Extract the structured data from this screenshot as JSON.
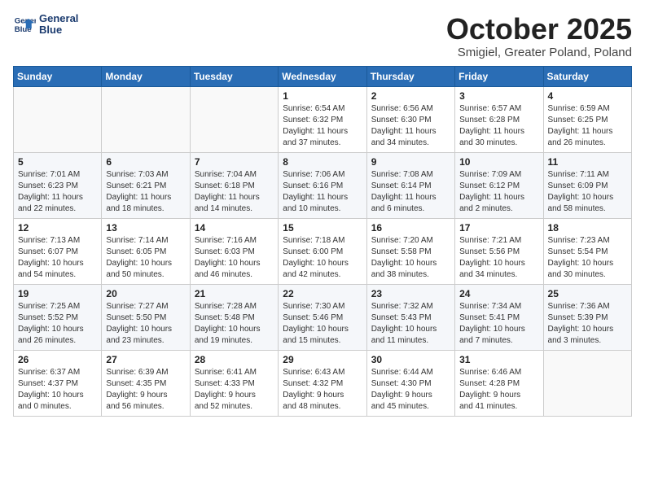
{
  "header": {
    "logo_line1": "General",
    "logo_line2": "Blue",
    "month_title": "October 2025",
    "subtitle": "Smigiel, Greater Poland, Poland"
  },
  "days_of_week": [
    "Sunday",
    "Monday",
    "Tuesday",
    "Wednesday",
    "Thursday",
    "Friday",
    "Saturday"
  ],
  "weeks": [
    [
      {
        "day": "",
        "info": ""
      },
      {
        "day": "",
        "info": ""
      },
      {
        "day": "",
        "info": ""
      },
      {
        "day": "1",
        "info": "Sunrise: 6:54 AM\nSunset: 6:32 PM\nDaylight: 11 hours\nand 37 minutes."
      },
      {
        "day": "2",
        "info": "Sunrise: 6:56 AM\nSunset: 6:30 PM\nDaylight: 11 hours\nand 34 minutes."
      },
      {
        "day": "3",
        "info": "Sunrise: 6:57 AM\nSunset: 6:28 PM\nDaylight: 11 hours\nand 30 minutes."
      },
      {
        "day": "4",
        "info": "Sunrise: 6:59 AM\nSunset: 6:25 PM\nDaylight: 11 hours\nand 26 minutes."
      }
    ],
    [
      {
        "day": "5",
        "info": "Sunrise: 7:01 AM\nSunset: 6:23 PM\nDaylight: 11 hours\nand 22 minutes."
      },
      {
        "day": "6",
        "info": "Sunrise: 7:03 AM\nSunset: 6:21 PM\nDaylight: 11 hours\nand 18 minutes."
      },
      {
        "day": "7",
        "info": "Sunrise: 7:04 AM\nSunset: 6:18 PM\nDaylight: 11 hours\nand 14 minutes."
      },
      {
        "day": "8",
        "info": "Sunrise: 7:06 AM\nSunset: 6:16 PM\nDaylight: 11 hours\nand 10 minutes."
      },
      {
        "day": "9",
        "info": "Sunrise: 7:08 AM\nSunset: 6:14 PM\nDaylight: 11 hours\nand 6 minutes."
      },
      {
        "day": "10",
        "info": "Sunrise: 7:09 AM\nSunset: 6:12 PM\nDaylight: 11 hours\nand 2 minutes."
      },
      {
        "day": "11",
        "info": "Sunrise: 7:11 AM\nSunset: 6:09 PM\nDaylight: 10 hours\nand 58 minutes."
      }
    ],
    [
      {
        "day": "12",
        "info": "Sunrise: 7:13 AM\nSunset: 6:07 PM\nDaylight: 10 hours\nand 54 minutes."
      },
      {
        "day": "13",
        "info": "Sunrise: 7:14 AM\nSunset: 6:05 PM\nDaylight: 10 hours\nand 50 minutes."
      },
      {
        "day": "14",
        "info": "Sunrise: 7:16 AM\nSunset: 6:03 PM\nDaylight: 10 hours\nand 46 minutes."
      },
      {
        "day": "15",
        "info": "Sunrise: 7:18 AM\nSunset: 6:00 PM\nDaylight: 10 hours\nand 42 minutes."
      },
      {
        "day": "16",
        "info": "Sunrise: 7:20 AM\nSunset: 5:58 PM\nDaylight: 10 hours\nand 38 minutes."
      },
      {
        "day": "17",
        "info": "Sunrise: 7:21 AM\nSunset: 5:56 PM\nDaylight: 10 hours\nand 34 minutes."
      },
      {
        "day": "18",
        "info": "Sunrise: 7:23 AM\nSunset: 5:54 PM\nDaylight: 10 hours\nand 30 minutes."
      }
    ],
    [
      {
        "day": "19",
        "info": "Sunrise: 7:25 AM\nSunset: 5:52 PM\nDaylight: 10 hours\nand 26 minutes."
      },
      {
        "day": "20",
        "info": "Sunrise: 7:27 AM\nSunset: 5:50 PM\nDaylight: 10 hours\nand 23 minutes."
      },
      {
        "day": "21",
        "info": "Sunrise: 7:28 AM\nSunset: 5:48 PM\nDaylight: 10 hours\nand 19 minutes."
      },
      {
        "day": "22",
        "info": "Sunrise: 7:30 AM\nSunset: 5:46 PM\nDaylight: 10 hours\nand 15 minutes."
      },
      {
        "day": "23",
        "info": "Sunrise: 7:32 AM\nSunset: 5:43 PM\nDaylight: 10 hours\nand 11 minutes."
      },
      {
        "day": "24",
        "info": "Sunrise: 7:34 AM\nSunset: 5:41 PM\nDaylight: 10 hours\nand 7 minutes."
      },
      {
        "day": "25",
        "info": "Sunrise: 7:36 AM\nSunset: 5:39 PM\nDaylight: 10 hours\nand 3 minutes."
      }
    ],
    [
      {
        "day": "26",
        "info": "Sunrise: 6:37 AM\nSunset: 4:37 PM\nDaylight: 10 hours\nand 0 minutes."
      },
      {
        "day": "27",
        "info": "Sunrise: 6:39 AM\nSunset: 4:35 PM\nDaylight: 9 hours\nand 56 minutes."
      },
      {
        "day": "28",
        "info": "Sunrise: 6:41 AM\nSunset: 4:33 PM\nDaylight: 9 hours\nand 52 minutes."
      },
      {
        "day": "29",
        "info": "Sunrise: 6:43 AM\nSunset: 4:32 PM\nDaylight: 9 hours\nand 48 minutes."
      },
      {
        "day": "30",
        "info": "Sunrise: 6:44 AM\nSunset: 4:30 PM\nDaylight: 9 hours\nand 45 minutes."
      },
      {
        "day": "31",
        "info": "Sunrise: 6:46 AM\nSunset: 4:28 PM\nDaylight: 9 hours\nand 41 minutes."
      },
      {
        "day": "",
        "info": ""
      }
    ]
  ]
}
